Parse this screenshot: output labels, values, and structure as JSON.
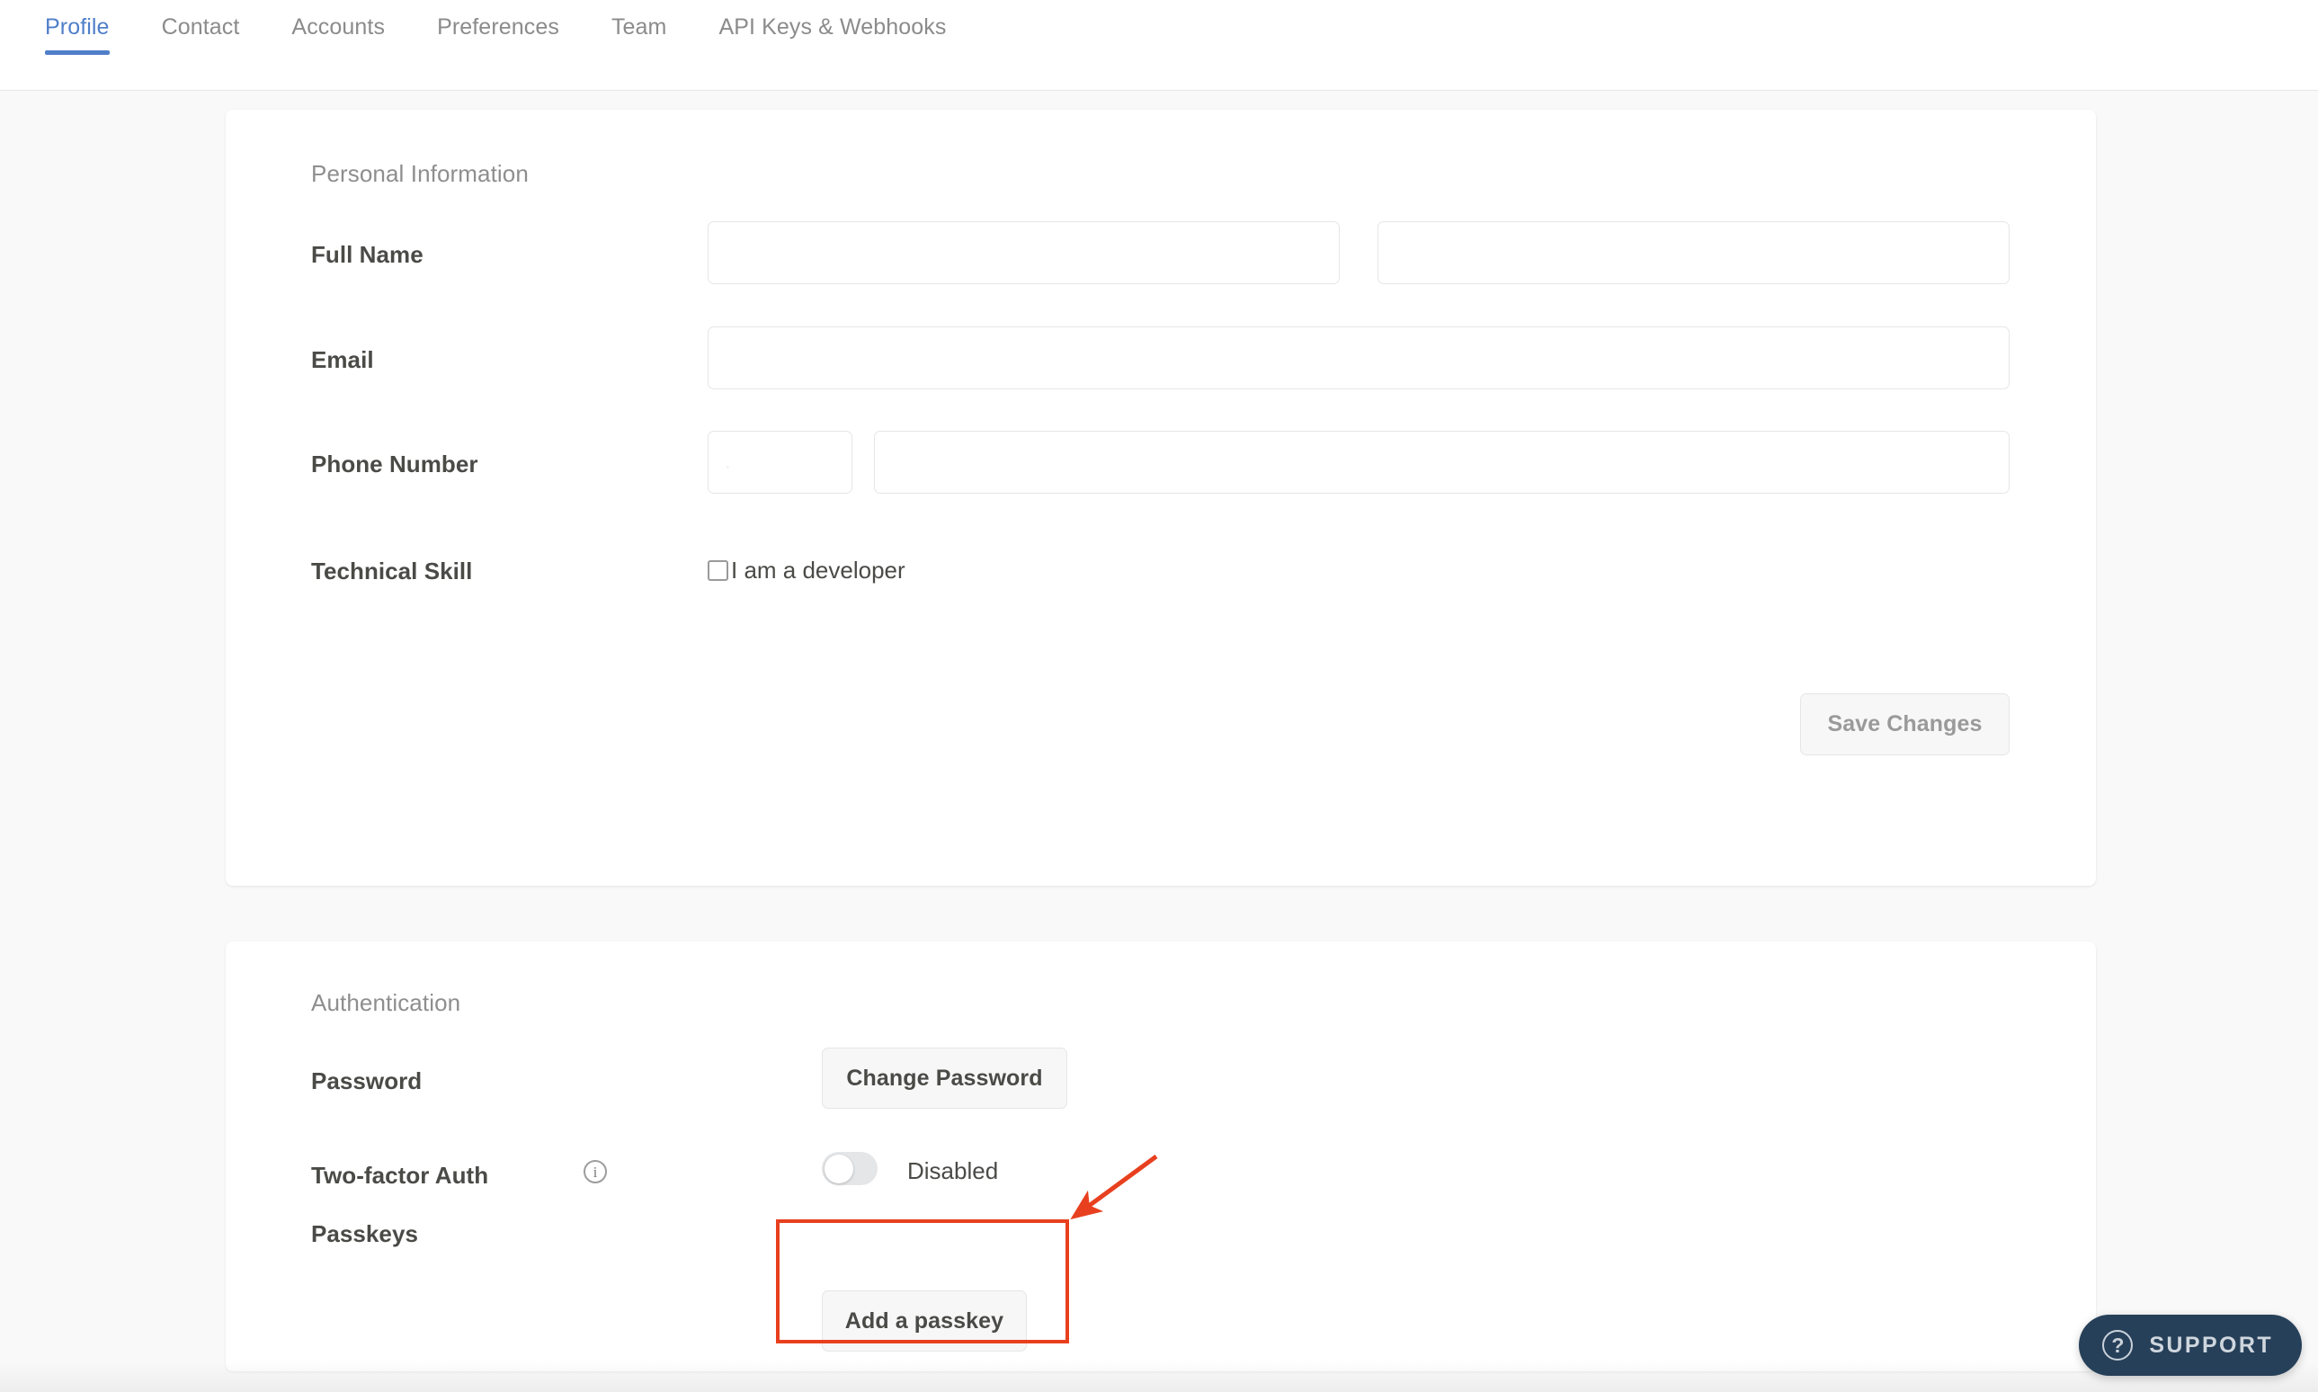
{
  "tabs": [
    {
      "label": "Profile",
      "active": true
    },
    {
      "label": "Contact",
      "active": false
    },
    {
      "label": "Accounts",
      "active": false
    },
    {
      "label": "Preferences",
      "active": false
    },
    {
      "label": "Team",
      "active": false
    },
    {
      "label": "API Keys & Webhooks",
      "active": false
    }
  ],
  "personal": {
    "section_title": "Personal Information",
    "rows": {
      "full_name": {
        "label": "Full Name",
        "first_value": "",
        "first_placeholder": "",
        "last_value": "",
        "last_placeholder": ""
      },
      "email": {
        "label": "Email",
        "value": "",
        "placeholder": ""
      },
      "phone": {
        "label": "Phone Number",
        "country_code_value": "",
        "country_code_placeholder": ".",
        "number_value": "",
        "number_placeholder": ""
      },
      "technical_skill": {
        "label": "Technical Skill",
        "checkbox_label": "I am a developer",
        "checked": false
      }
    },
    "save_button": "Save Changes"
  },
  "authentication": {
    "section_title": "Authentication",
    "rows": {
      "password": {
        "label": "Password",
        "button": "Change Password"
      },
      "two_factor": {
        "label": "Two-factor Auth",
        "info_icon": "info-icon",
        "toggle_state": "off",
        "state_text": "Disabled"
      },
      "passkeys": {
        "label": "Passkeys",
        "button": "Add a passkey"
      }
    }
  },
  "support_widget": {
    "icon": "question-circle-icon",
    "label": "SUPPORT"
  },
  "annotation": {
    "highlight_target": "Add a passkey",
    "color": "#e8401f"
  },
  "colors": {
    "accent": "#4f7fc9",
    "page_bg": "#f9f9f9",
    "card_bg": "#ffffff",
    "label_text": "#4a4a47",
    "muted_text": "#8e8e8e",
    "border": "#e6e6e6",
    "support_bg": "#274059",
    "annotation": "#e8401f"
  }
}
